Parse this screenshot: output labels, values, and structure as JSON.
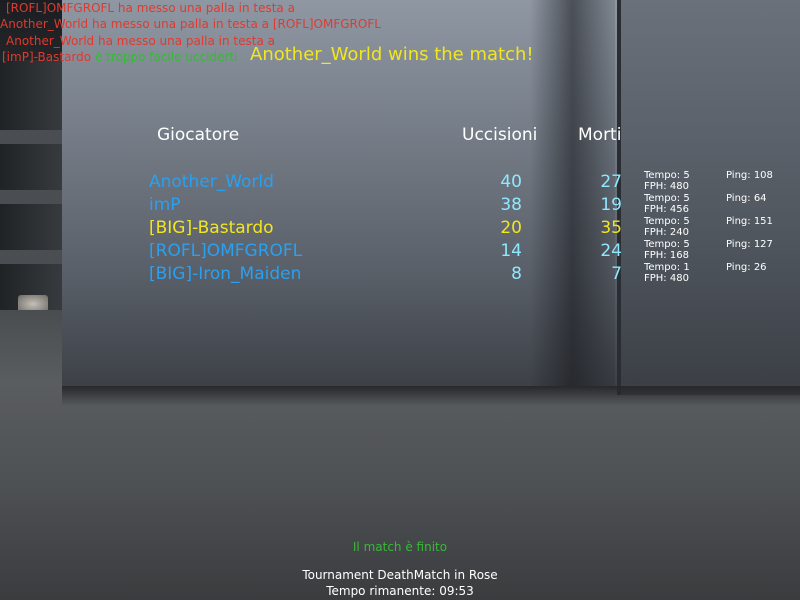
{
  "chat": {
    "line1": "[ROFL]OMFGROFL ha messo una palla in testa a",
    "line2a": "Another_World",
    "line2b": "ha messo una palla in testa a [ROFL]OMFGROFL",
    "line3": "Another_World ha messo una palla in testa a",
    "line4a": "[imP]-Bastardo",
    "line4b": "è troppo facile ucciderti"
  },
  "winner_text": "Another_World wins the match!",
  "scoreboard": {
    "headers": {
      "player": "Giocatore",
      "kills": "Uccisioni",
      "deaths": "Morti"
    },
    "rows": [
      {
        "name": "Another_World",
        "kills": "40",
        "deaths": "27",
        "time": "Tempo: 5",
        "fph": "FPH: 480",
        "ping": "Ping: 108",
        "name_color": "#2aa0f0",
        "score_color": "#8fe8ff"
      },
      {
        "name": "imP",
        "kills": "38",
        "deaths": "19",
        "time": "Tempo: 5",
        "fph": "FPH: 456",
        "ping": "Ping: 64",
        "name_color": "#2aa0f0",
        "score_color": "#8fe8ff"
      },
      {
        "name": "[BIG]-Bastardo",
        "kills": "20",
        "deaths": "35",
        "time": "Tempo: 5",
        "fph": "FPH: 240",
        "ping": "Ping: 151",
        "name_color": "#f2e61e",
        "score_color": "#f2e61e"
      },
      {
        "name": "[ROFL]OMFGROFL",
        "kills": "14",
        "deaths": "24",
        "time": "Tempo: 5",
        "fph": "FPH: 168",
        "ping": "Ping: 127",
        "name_color": "#2aa0f0",
        "score_color": "#8fe8ff"
      },
      {
        "name": "[BIG]-Iron_Maiden",
        "kills": "8",
        "deaths": "7",
        "time": "Tempo: 1",
        "fph": "FPH: 480",
        "ping": "Ping: 26",
        "name_color": "#2aa0f0",
        "score_color": "#8fe8ff"
      }
    ]
  },
  "match_status": "Il match è finito",
  "game_mode": "Tournament DeathMatch in Rose",
  "time_left_label": "Tempo rimanente:",
  "time_left_value": "09:53",
  "colors": {
    "chat_red": "#e03a2e",
    "chat_green": "#38b838",
    "winner_yellow": "#f2e61e",
    "player_blue": "#2aa0f0",
    "footer_white": "#ffffff"
  }
}
